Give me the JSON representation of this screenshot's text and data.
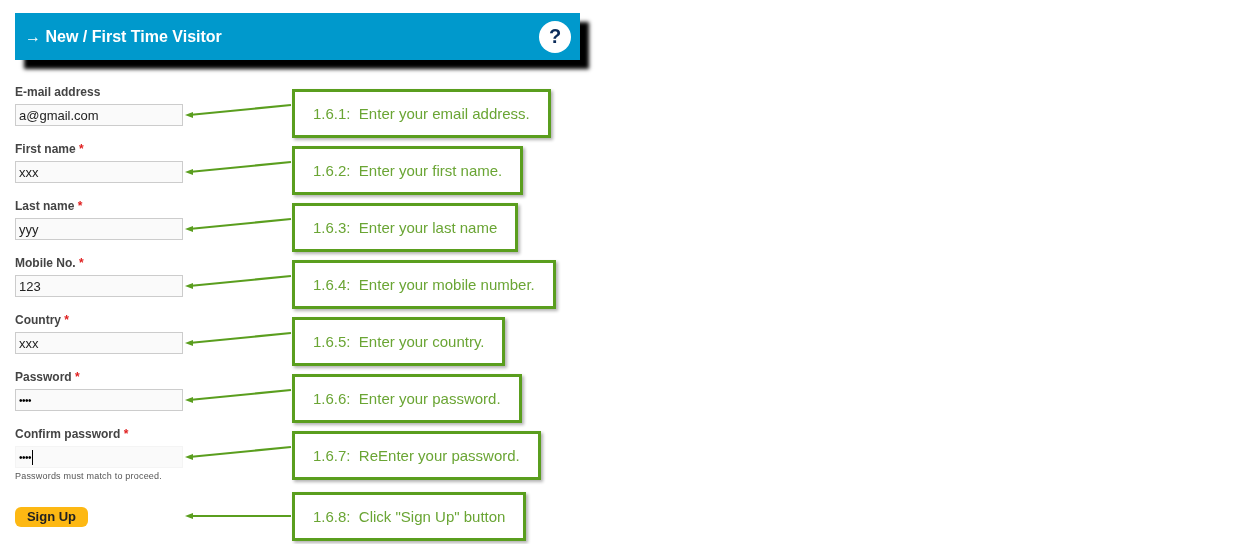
{
  "header": {
    "title": "→ New / First Time Visitor",
    "help": "?"
  },
  "fields": [
    {
      "kind": "text",
      "label": "E-mail address",
      "required": false,
      "value": "a@gmail.com",
      "focused": false,
      "callout": "1.6.1:  Enter your email address."
    },
    {
      "kind": "text",
      "label": "First name",
      "required": true,
      "value": "xxx",
      "focused": false,
      "callout": "1.6.2:  Enter your first name."
    },
    {
      "kind": "text",
      "label": "Last name",
      "required": true,
      "value": "yyy",
      "focused": false,
      "callout": "1.6.3:  Enter your last name"
    },
    {
      "kind": "text",
      "label": "Mobile No.",
      "required": true,
      "value": "123",
      "focused": false,
      "callout": "1.6.4:  Enter your mobile number."
    },
    {
      "kind": "text",
      "label": "Country",
      "required": true,
      "value": "xxx",
      "focused": false,
      "callout": "1.6.5:  Enter your country."
    },
    {
      "kind": "password",
      "label": "Password",
      "required": true,
      "value": "••••",
      "focused": false,
      "callout": "1.6.6:  Enter your password."
    },
    {
      "kind": "password",
      "label": "Confirm password",
      "required": true,
      "value": "••••",
      "focused": true,
      "hint": "Passwords must match to proceed.",
      "callout": "1.6.7:  ReEnter your password."
    }
  ],
  "required_mark": "*",
  "submit": {
    "label": "Sign Up",
    "callout": "1.6.8:  Click \"Sign Up\" button"
  }
}
